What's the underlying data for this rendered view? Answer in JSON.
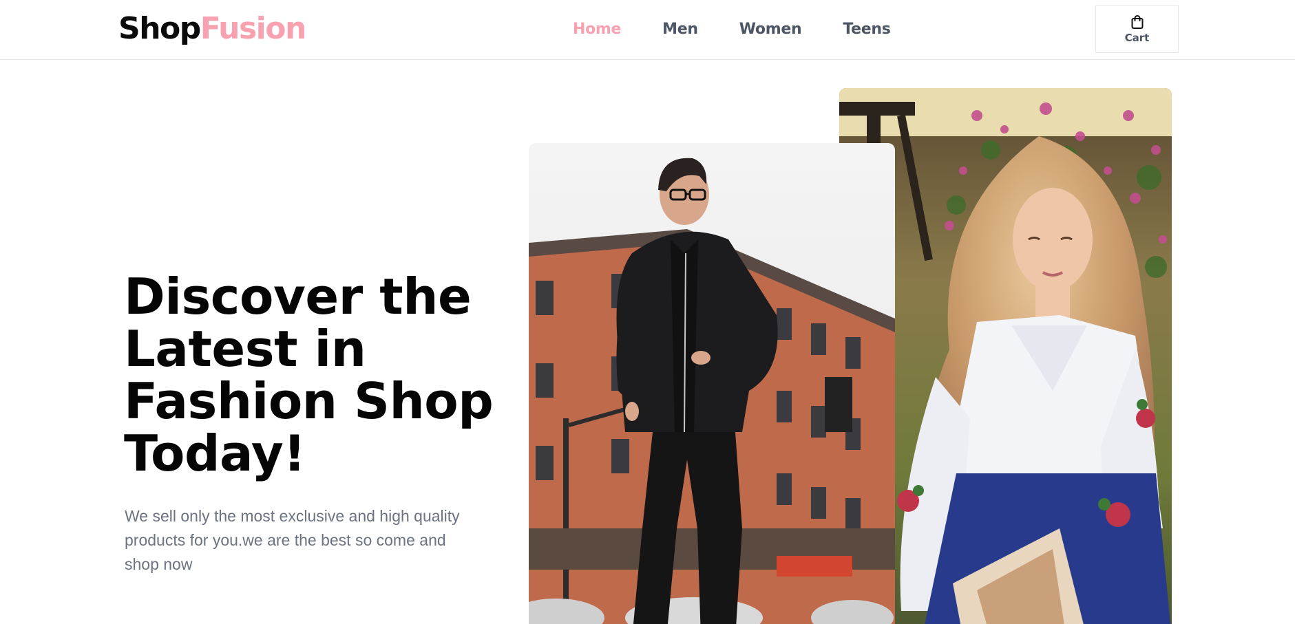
{
  "brand": {
    "part1": "Shop",
    "part2": "Fusion",
    "accent_color": "#f7a1b1"
  },
  "nav": {
    "items": [
      {
        "label": "Home",
        "active": true
      },
      {
        "label": "Men",
        "active": false
      },
      {
        "label": "Women",
        "active": false
      },
      {
        "label": "Teens",
        "active": false
      }
    ]
  },
  "cart": {
    "label": "Cart",
    "icon": "shopping-bag-icon"
  },
  "hero": {
    "title": "Discover the Latest in Fashion Shop Today!",
    "subtitle": "We sell only the most exclusive and high quality products for you.we are the best so come and shop now"
  },
  "images": {
    "man": "photo of a man in a black jacket walking on a city street",
    "woman": "photo of a woman with long wavy hair in an embroidered white blouse holding a magazine"
  },
  "colors": {
    "text_dark": "#050505",
    "text_muted": "#6b7280",
    "nav_text": "#4b5563",
    "border": "#e5e7eb"
  }
}
